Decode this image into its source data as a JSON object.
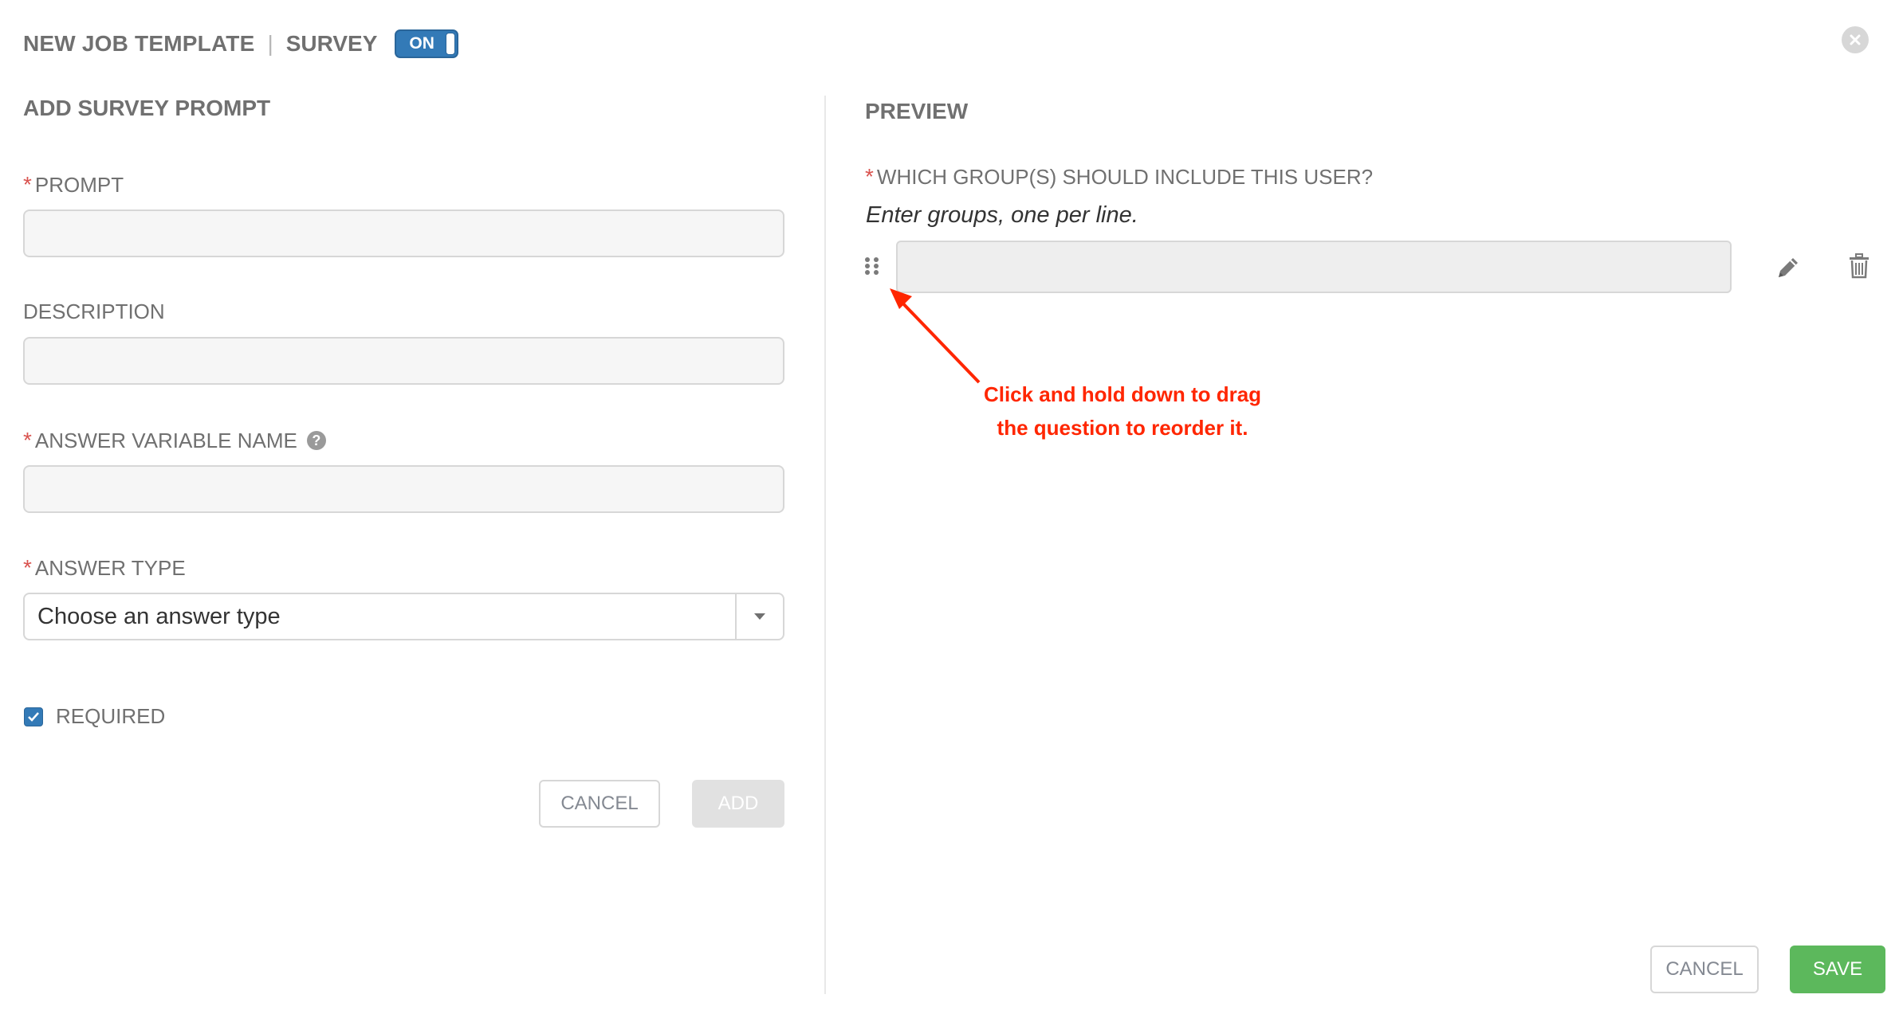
{
  "header": {
    "title": "NEW JOB TEMPLATE",
    "separator": "|",
    "section": "SURVEY",
    "toggle_label": "ON"
  },
  "left": {
    "title": "ADD SURVEY PROMPT",
    "prompt_label": "PROMPT",
    "prompt_value": "",
    "description_label": "DESCRIPTION",
    "description_value": "",
    "variable_label": "ANSWER VARIABLE NAME",
    "variable_value": "",
    "answer_type_label": "ANSWER TYPE",
    "answer_type_value": "Choose an answer type",
    "required_label": "REQUIRED",
    "required_checked": true,
    "cancel_label": "CANCEL",
    "add_label": "ADD"
  },
  "preview": {
    "title": "PREVIEW",
    "question": "WHICH GROUP(S) SHOULD INCLUDE THIS USER?",
    "hint": "Enter groups, one per line.",
    "annotation_line1": "Click and hold down to drag",
    "annotation_line2": "the question to reorder it."
  },
  "footer": {
    "cancel_label": "CANCEL",
    "save_label": "SAVE"
  },
  "colors": {
    "accent": "#337ab7",
    "required": "#d9534f",
    "success": "#5cb85c",
    "annotation": "#ff2600"
  },
  "icons": [
    "close-icon",
    "help-icon",
    "chevron-down-icon",
    "checkmark-icon",
    "drag-handle-icon",
    "pencil-icon",
    "trash-icon",
    "arrow-icon"
  ]
}
